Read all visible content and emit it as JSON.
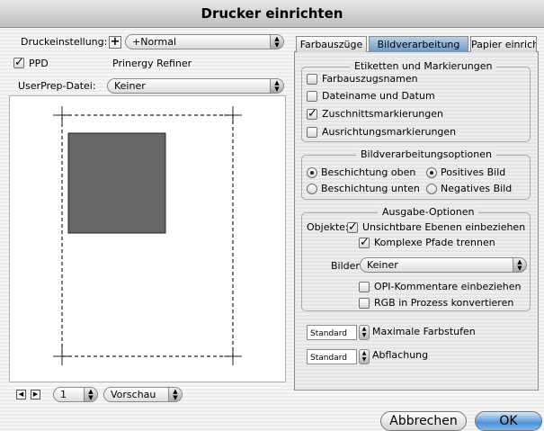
{
  "window": {
    "title": "Drucker einrichten"
  },
  "left": {
    "druckeinstellung_label": "Druckeinstellung:",
    "druckeinstellung_value": "+Normal",
    "ppd_label": "PPD",
    "ppd_value": "Prinergy Refiner",
    "userprep_label": "UserPrep-Datei:",
    "userprep_value": "Keiner",
    "page_value": "1",
    "view_value": "Vorschau"
  },
  "tabs": [
    {
      "label": "Farbauszüge"
    },
    {
      "label": "Bildverarbeitung"
    },
    {
      "label": "Papier einrichten"
    }
  ],
  "etiketten": {
    "title": "Etiketten und Markierungen",
    "items": [
      {
        "label": "Farbauszugsnamen",
        "checked": false
      },
      {
        "label": "Dateiname und Datum",
        "checked": false
      },
      {
        "label": "Zuschnittsmarkierungen",
        "checked": true
      },
      {
        "label": "Ausrichtungsmarkierungen",
        "checked": false
      }
    ]
  },
  "bildopt": {
    "title": "Bildverarbeitungsoptionen",
    "beschichtung_oben": "Beschichtung oben",
    "beschichtung_unten": "Beschichtung unten",
    "positives_bild": "Positives Bild",
    "negatives_bild": "Negatives Bild"
  },
  "ausgabe": {
    "title": "Ausgabe-Optionen",
    "objekte_label": "Objekte:",
    "unsichtbare": "Unsichtbare Ebenen einbeziehen",
    "komplexe": "Komplexe Pfade trennen",
    "bilder_label": "Bilder",
    "bilder_value": "Keiner",
    "opi": "OPI-Kommentare einbeziehen",
    "rgb": "RGB in Prozess konvertieren"
  },
  "farbstufen": {
    "select": "Standard",
    "label": "Maximale Farbstufen"
  },
  "abflachung": {
    "select": "Standard",
    "label": "Abflachung"
  },
  "buttons": {
    "cancel": "Abbrechen",
    "ok": "OK"
  }
}
